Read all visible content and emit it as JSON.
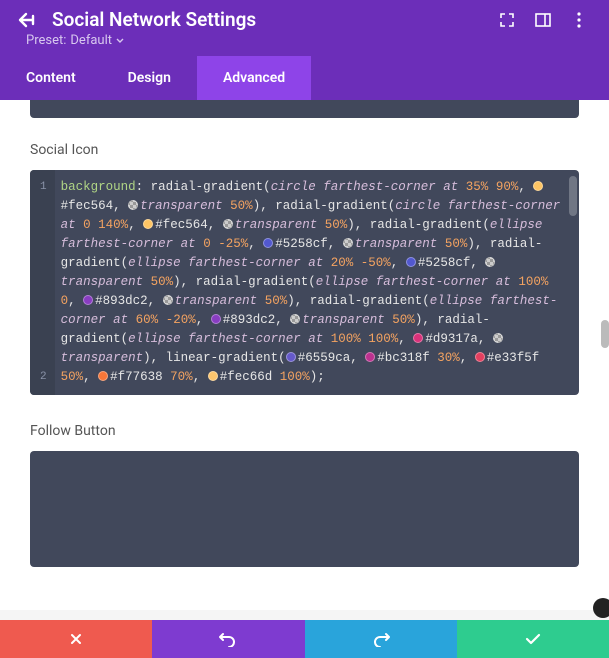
{
  "header": {
    "title": "Social Network Settings",
    "preset_label": "Preset:",
    "preset_value": "Default"
  },
  "tabs": {
    "content": "Content",
    "design": "Design",
    "advanced": "Advanced"
  },
  "fields": {
    "social_icon_label": "Social Icon",
    "follow_button_label": "Follow Button"
  },
  "code": {
    "tokens": [
      {
        "t": "prop",
        "v": "background"
      },
      {
        "t": "punc",
        "v": ": "
      },
      {
        "t": "fn",
        "v": "radial-gradient"
      },
      {
        "t": "punc",
        "v": "("
      },
      {
        "t": "kw",
        "v": "circle"
      },
      {
        "t": "punc",
        "v": " "
      },
      {
        "t": "kw",
        "v": "farthest-corner"
      },
      {
        "t": "punc",
        "v": " "
      },
      {
        "t": "kw",
        "v": "at"
      },
      {
        "t": "punc",
        "v": " "
      },
      {
        "t": "num",
        "v": "35%"
      },
      {
        "t": "punc",
        "v": " "
      },
      {
        "t": "num",
        "v": "90%"
      },
      {
        "t": "punc",
        "v": ", "
      },
      {
        "t": "sw",
        "c": "#fec564"
      },
      {
        "t": "color",
        "v": "#fec564"
      },
      {
        "t": "punc",
        "v": ", "
      },
      {
        "t": "sw",
        "c": "transparent"
      },
      {
        "t": "kw",
        "v": "transparent"
      },
      {
        "t": "punc",
        "v": " "
      },
      {
        "t": "num",
        "v": "50%"
      },
      {
        "t": "punc",
        "v": "), "
      },
      {
        "t": "fn",
        "v": "radial-gradient"
      },
      {
        "t": "punc",
        "v": "("
      },
      {
        "t": "kw",
        "v": "circle"
      },
      {
        "t": "punc",
        "v": " "
      },
      {
        "t": "kw",
        "v": "farthest-corner"
      },
      {
        "t": "punc",
        "v": " "
      },
      {
        "t": "kw",
        "v": "at"
      },
      {
        "t": "punc",
        "v": " "
      },
      {
        "t": "num",
        "v": "0"
      },
      {
        "t": "punc",
        "v": " "
      },
      {
        "t": "num",
        "v": "140%"
      },
      {
        "t": "punc",
        "v": ", "
      },
      {
        "t": "sw",
        "c": "#fec564"
      },
      {
        "t": "color",
        "v": "#fec564"
      },
      {
        "t": "punc",
        "v": ", "
      },
      {
        "t": "sw",
        "c": "transparent"
      },
      {
        "t": "kw",
        "v": "transparent"
      },
      {
        "t": "punc",
        "v": " "
      },
      {
        "t": "num",
        "v": "50%"
      },
      {
        "t": "punc",
        "v": "), "
      },
      {
        "t": "fn",
        "v": "radial-gradient"
      },
      {
        "t": "punc",
        "v": "("
      },
      {
        "t": "kw",
        "v": "ellipse"
      },
      {
        "t": "punc",
        "v": " "
      },
      {
        "t": "kw",
        "v": "farthest-corner"
      },
      {
        "t": "punc",
        "v": " "
      },
      {
        "t": "kw",
        "v": "at"
      },
      {
        "t": "punc",
        "v": " "
      },
      {
        "t": "num",
        "v": "0"
      },
      {
        "t": "punc",
        "v": " "
      },
      {
        "t": "num",
        "v": "-25%"
      },
      {
        "t": "punc",
        "v": ", "
      },
      {
        "t": "sw",
        "c": "#5258cf"
      },
      {
        "t": "color",
        "v": "#5258cf"
      },
      {
        "t": "punc",
        "v": ", "
      },
      {
        "t": "sw",
        "c": "transparent"
      },
      {
        "t": "kw",
        "v": "transparent"
      },
      {
        "t": "punc",
        "v": " "
      },
      {
        "t": "num",
        "v": "50%"
      },
      {
        "t": "punc",
        "v": "), "
      },
      {
        "t": "fn",
        "v": "radial-gradient"
      },
      {
        "t": "punc",
        "v": "("
      },
      {
        "t": "kw",
        "v": "ellipse"
      },
      {
        "t": "punc",
        "v": " "
      },
      {
        "t": "kw",
        "v": "farthest-corner"
      },
      {
        "t": "punc",
        "v": " "
      },
      {
        "t": "kw",
        "v": "at"
      },
      {
        "t": "punc",
        "v": " "
      },
      {
        "t": "num",
        "v": "20%"
      },
      {
        "t": "punc",
        "v": " "
      },
      {
        "t": "num",
        "v": "-50%"
      },
      {
        "t": "punc",
        "v": ", "
      },
      {
        "t": "sw",
        "c": "#5258cf"
      },
      {
        "t": "color",
        "v": "#5258cf"
      },
      {
        "t": "punc",
        "v": ", "
      },
      {
        "t": "sw",
        "c": "transparent"
      },
      {
        "t": "kw",
        "v": "transparent"
      },
      {
        "t": "punc",
        "v": " "
      },
      {
        "t": "num",
        "v": "50%"
      },
      {
        "t": "punc",
        "v": "), "
      },
      {
        "t": "fn",
        "v": "radial-gradient"
      },
      {
        "t": "punc",
        "v": "("
      },
      {
        "t": "kw",
        "v": "ellipse"
      },
      {
        "t": "punc",
        "v": " "
      },
      {
        "t": "kw",
        "v": "farthest-corner"
      },
      {
        "t": "punc",
        "v": " "
      },
      {
        "t": "kw",
        "v": "at"
      },
      {
        "t": "punc",
        "v": " "
      },
      {
        "t": "num",
        "v": "100%"
      },
      {
        "t": "punc",
        "v": " "
      },
      {
        "t": "num",
        "v": "0"
      },
      {
        "t": "punc",
        "v": ", "
      },
      {
        "t": "sw",
        "c": "#893dc2"
      },
      {
        "t": "color",
        "v": "#893dc2"
      },
      {
        "t": "punc",
        "v": ", "
      },
      {
        "t": "sw",
        "c": "transparent"
      },
      {
        "t": "kw",
        "v": "transparent"
      },
      {
        "t": "punc",
        "v": " "
      },
      {
        "t": "num",
        "v": "50%"
      },
      {
        "t": "punc",
        "v": "), "
      },
      {
        "t": "fn",
        "v": "radial-gradient"
      },
      {
        "t": "punc",
        "v": "("
      },
      {
        "t": "kw",
        "v": "ellipse"
      },
      {
        "t": "punc",
        "v": " "
      },
      {
        "t": "kw",
        "v": "farthest-corner"
      },
      {
        "t": "punc",
        "v": " "
      },
      {
        "t": "kw",
        "v": "at"
      },
      {
        "t": "punc",
        "v": " "
      },
      {
        "t": "num",
        "v": "60%"
      },
      {
        "t": "punc",
        "v": " "
      },
      {
        "t": "num",
        "v": "-20%"
      },
      {
        "t": "punc",
        "v": ", "
      },
      {
        "t": "sw",
        "c": "#893dc2"
      },
      {
        "t": "color",
        "v": "#893dc2"
      },
      {
        "t": "punc",
        "v": ", "
      },
      {
        "t": "sw",
        "c": "transparent"
      },
      {
        "t": "kw",
        "v": "transparent"
      },
      {
        "t": "punc",
        "v": " "
      },
      {
        "t": "num",
        "v": "50%"
      },
      {
        "t": "punc",
        "v": "), "
      },
      {
        "t": "fn",
        "v": "radial-gradient"
      },
      {
        "t": "punc",
        "v": "("
      },
      {
        "t": "kw",
        "v": "ellipse"
      },
      {
        "t": "punc",
        "v": " "
      },
      {
        "t": "kw",
        "v": "farthest-corner"
      },
      {
        "t": "punc",
        "v": " "
      },
      {
        "t": "kw",
        "v": "at"
      },
      {
        "t": "punc",
        "v": " "
      },
      {
        "t": "num",
        "v": "100%"
      },
      {
        "t": "punc",
        "v": " "
      },
      {
        "t": "num",
        "v": "100%"
      },
      {
        "t": "punc",
        "v": ", "
      },
      {
        "t": "sw",
        "c": "#d9317a"
      },
      {
        "t": "color",
        "v": "#d9317a"
      },
      {
        "t": "punc",
        "v": ", "
      },
      {
        "t": "sw",
        "c": "transparent"
      },
      {
        "t": "kw",
        "v": "transparent"
      },
      {
        "t": "punc",
        "v": "), "
      },
      {
        "t": "fn",
        "v": "linear-gradient"
      },
      {
        "t": "punc",
        "v": "("
      },
      {
        "t": "sw",
        "c": "#6559ca"
      },
      {
        "t": "color",
        "v": "#6559ca"
      },
      {
        "t": "punc",
        "v": ", "
      },
      {
        "t": "sw",
        "c": "#bc318f"
      },
      {
        "t": "color",
        "v": "#bc318f"
      },
      {
        "t": "punc",
        "v": " "
      },
      {
        "t": "num",
        "v": "30%"
      },
      {
        "t": "punc",
        "v": ", "
      },
      {
        "t": "sw",
        "c": "#e33f5f"
      },
      {
        "t": "color",
        "v": "#e33f5f"
      },
      {
        "t": "punc",
        "v": " "
      },
      {
        "t": "num",
        "v": "50%"
      },
      {
        "t": "punc",
        "v": ", "
      },
      {
        "t": "sw",
        "c": "#f77638"
      },
      {
        "t": "color",
        "v": "#f77638"
      },
      {
        "t": "punc",
        "v": " "
      },
      {
        "t": "num",
        "v": "70%"
      },
      {
        "t": "punc",
        "v": ", "
      },
      {
        "t": "sw",
        "c": "#fec66d"
      },
      {
        "t": "color",
        "v": "#fec66d"
      },
      {
        "t": "punc",
        "v": " "
      },
      {
        "t": "num",
        "v": "100%"
      },
      {
        "t": "punc",
        "v": ");"
      }
    ],
    "line2_empty": ""
  }
}
